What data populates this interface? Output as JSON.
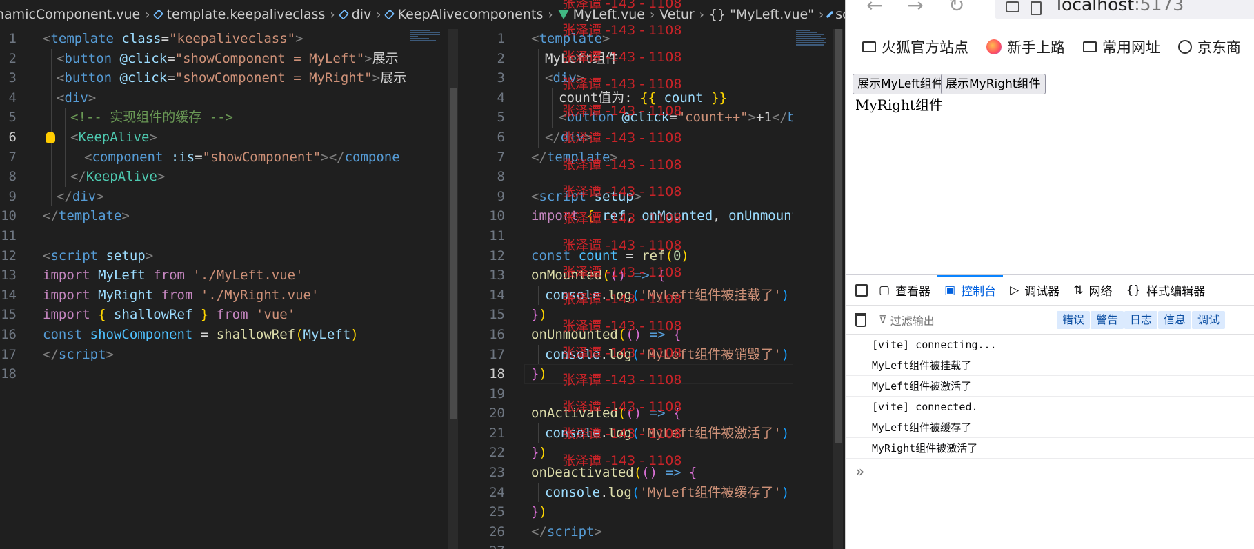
{
  "left_editor": {
    "breadcrumbs": [
      "namicComponent.vue",
      "template.keepaliveclass",
      "div",
      "KeepAlive"
    ],
    "current_line": 6,
    "lines": [
      {
        "n": "1",
        "tokens": [
          [
            "<",
            "ang"
          ],
          [
            "template",
            "tag"
          ],
          [
            " ",
            ""
          ],
          [
            "class",
            "attr"
          ],
          [
            "=",
            ""
          ],
          [
            "\"keepaliveclass\"",
            "str"
          ],
          [
            ">",
            "ang"
          ]
        ],
        "indent": 0
      },
      {
        "n": "2",
        "tokens": [
          [
            "<",
            "ang"
          ],
          [
            "button",
            "tag"
          ],
          [
            " ",
            ""
          ],
          [
            "@click",
            "attr"
          ],
          [
            "=",
            ""
          ],
          [
            "\"showComponent = MyLeft\"",
            "str"
          ],
          [
            ">",
            "ang"
          ],
          [
            "展示",
            "plain"
          ]
        ],
        "indent": 1
      },
      {
        "n": "3",
        "tokens": [
          [
            "<",
            "ang"
          ],
          [
            "button",
            "tag"
          ],
          [
            " ",
            ""
          ],
          [
            "@click",
            "attr"
          ],
          [
            "=",
            ""
          ],
          [
            "\"showComponent = MyRight\"",
            "str"
          ],
          [
            ">",
            "ang"
          ],
          [
            "展示",
            "plain"
          ]
        ],
        "indent": 1
      },
      {
        "n": "4",
        "tokens": [
          [
            "<",
            "ang"
          ],
          [
            "div",
            "tag"
          ],
          [
            ">",
            "ang"
          ]
        ],
        "indent": 1
      },
      {
        "n": "5",
        "tokens": [
          [
            "<!-- 实现组件的缓存 -->",
            "cmt"
          ]
        ],
        "indent": 2
      },
      {
        "n": "6",
        "tokens": [
          [
            "<",
            "ang"
          ],
          [
            "KeepAlive",
            "comp"
          ],
          [
            ">",
            "ang"
          ]
        ],
        "indent": 2
      },
      {
        "n": "7",
        "tokens": [
          [
            "<",
            "ang"
          ],
          [
            "component",
            "tag"
          ],
          [
            " ",
            ""
          ],
          [
            ":is",
            "attr"
          ],
          [
            "=",
            ""
          ],
          [
            "\"showComponent\"",
            "str"
          ],
          [
            ">",
            "ang"
          ],
          [
            "</",
            "ang"
          ],
          [
            "compone",
            "tag"
          ]
        ],
        "indent": 3
      },
      {
        "n": "8",
        "tokens": [
          [
            "</",
            "ang"
          ],
          [
            "KeepAlive",
            "comp"
          ],
          [
            ">",
            "ang"
          ]
        ],
        "indent": 2
      },
      {
        "n": "9",
        "tokens": [
          [
            "</",
            "ang"
          ],
          [
            "div",
            "tag"
          ],
          [
            ">",
            "ang"
          ]
        ],
        "indent": 1
      },
      {
        "n": "10",
        "tokens": [
          [
            "</",
            "ang"
          ],
          [
            "template",
            "tag"
          ],
          [
            ">",
            "ang"
          ]
        ],
        "indent": 0
      },
      {
        "n": "11",
        "tokens": [],
        "indent": 0
      },
      {
        "n": "12",
        "tokens": [
          [
            "<",
            "ang"
          ],
          [
            "script",
            "tag"
          ],
          [
            " ",
            ""
          ],
          [
            "setup",
            "attr"
          ],
          [
            ">",
            "ang"
          ]
        ],
        "indent": 0
      },
      {
        "n": "13",
        "tokens": [
          [
            "import",
            "kwc"
          ],
          [
            " ",
            ""
          ],
          [
            "MyLeft",
            "var"
          ],
          [
            " ",
            ""
          ],
          [
            "from",
            "kwc"
          ],
          [
            " ",
            ""
          ],
          [
            "'./MyLeft.vue'",
            "str"
          ]
        ],
        "indent": 0
      },
      {
        "n": "14",
        "tokens": [
          [
            "import",
            "kwc"
          ],
          [
            " ",
            ""
          ],
          [
            "MyRight",
            "var"
          ],
          [
            " ",
            ""
          ],
          [
            "from",
            "kwc"
          ],
          [
            " ",
            ""
          ],
          [
            "'./MyRight.vue'",
            "str"
          ]
        ],
        "indent": 0
      },
      {
        "n": "15",
        "tokens": [
          [
            "import",
            "kwc"
          ],
          [
            " ",
            ""
          ],
          [
            "{",
            "br1"
          ],
          [
            " ",
            ""
          ],
          [
            "shallowRef",
            "var"
          ],
          [
            " ",
            ""
          ],
          [
            "}",
            "br1"
          ],
          [
            " ",
            ""
          ],
          [
            "from",
            "kwc"
          ],
          [
            " ",
            ""
          ],
          [
            "'vue'",
            "str"
          ]
        ],
        "indent": 0
      },
      {
        "n": "16",
        "tokens": [
          [
            "const",
            "kw"
          ],
          [
            " ",
            ""
          ],
          [
            "showComponent",
            "cvar"
          ],
          [
            " = ",
            ""
          ],
          [
            "shallowRef",
            "fn"
          ],
          [
            "(",
            "br1"
          ],
          [
            "MyLeft",
            "var"
          ],
          [
            ")",
            "br1"
          ]
        ],
        "indent": 0
      },
      {
        "n": "17",
        "tokens": [
          [
            "</",
            "ang"
          ],
          [
            "script",
            "tag"
          ],
          [
            ">",
            "ang"
          ]
        ],
        "indent": 0
      },
      {
        "n": "18",
        "tokens": [],
        "indent": 0
      }
    ]
  },
  "right_editor": {
    "breadcrumbs": [
      "components",
      "MyLeft.vue",
      "Vetur",
      "\"MyLeft.vue\"",
      "sc"
    ],
    "current_line": 18,
    "lines": [
      {
        "n": "1",
        "tokens": [
          [
            "<",
            "ang"
          ],
          [
            "template",
            "tag"
          ],
          [
            ">",
            "ang"
          ]
        ],
        "indent": 0
      },
      {
        "n": "2",
        "tokens": [
          [
            "MyLeft组件",
            "plain"
          ]
        ],
        "indent": 1
      },
      {
        "n": "3",
        "tokens": [
          [
            "<",
            "ang"
          ],
          [
            "div",
            "tag"
          ],
          [
            ">",
            "ang"
          ]
        ],
        "indent": 1
      },
      {
        "n": "4",
        "tokens": [
          [
            "count值为:",
            "plain"
          ],
          [
            " ",
            ""
          ],
          [
            "{{",
            "br1"
          ],
          [
            " ",
            ""
          ],
          [
            "count",
            "var"
          ],
          [
            " ",
            ""
          ],
          [
            "}}",
            "br1"
          ]
        ],
        "indent": 2
      },
      {
        "n": "5",
        "tokens": [
          [
            "<",
            "ang"
          ],
          [
            "button",
            "tag"
          ],
          [
            " ",
            ""
          ],
          [
            "@click",
            "attr"
          ],
          [
            "=",
            ""
          ],
          [
            "\"count++\"",
            "str"
          ],
          [
            ">",
            "ang"
          ],
          [
            "+1",
            "plain"
          ],
          [
            "</",
            "ang"
          ],
          [
            "b",
            "tag"
          ]
        ],
        "indent": 2
      },
      {
        "n": "6",
        "tokens": [
          [
            "</",
            "ang"
          ],
          [
            "div",
            "tag"
          ],
          [
            ">",
            "ang"
          ]
        ],
        "indent": 1
      },
      {
        "n": "7",
        "tokens": [
          [
            "</",
            "ang"
          ],
          [
            "template",
            "tag"
          ],
          [
            ">",
            "ang"
          ]
        ],
        "indent": 0
      },
      {
        "n": "8",
        "tokens": [],
        "indent": 0
      },
      {
        "n": "9",
        "tokens": [
          [
            "<",
            "ang"
          ],
          [
            "script",
            "tag"
          ],
          [
            " ",
            ""
          ],
          [
            "setup",
            "attr"
          ],
          [
            ">",
            "ang"
          ]
        ],
        "indent": 0
      },
      {
        "n": "10",
        "tokens": [
          [
            "import",
            "kwc"
          ],
          [
            " ",
            ""
          ],
          [
            "{",
            "br1"
          ],
          [
            " ",
            ""
          ],
          [
            "ref",
            "var"
          ],
          [
            ", ",
            ""
          ],
          [
            "onMounted",
            "var"
          ],
          [
            ", ",
            ""
          ],
          [
            "onUnmount",
            "var"
          ]
        ],
        "indent": 0
      },
      {
        "n": "11",
        "tokens": [],
        "indent": 0
      },
      {
        "n": "12",
        "tokens": [
          [
            "const",
            "kw"
          ],
          [
            " ",
            ""
          ],
          [
            "count",
            "cvar"
          ],
          [
            " = ",
            ""
          ],
          [
            "ref",
            "fn"
          ],
          [
            "(",
            "br1"
          ],
          [
            "0",
            "num"
          ],
          [
            ")",
            "br1"
          ]
        ],
        "indent": 0
      },
      {
        "n": "13",
        "tokens": [
          [
            "onMounted",
            "fn"
          ],
          [
            "(",
            "br1"
          ],
          [
            "(",
            "br2"
          ],
          [
            ")",
            "br2"
          ],
          [
            " ",
            ""
          ],
          [
            "=>",
            "kw"
          ],
          [
            " ",
            ""
          ],
          [
            "{",
            "br2"
          ]
        ],
        "indent": 0
      },
      {
        "n": "14",
        "tokens": [
          [
            "console",
            "var"
          ],
          [
            ".",
            ""
          ],
          [
            "log",
            "fn"
          ],
          [
            "(",
            "br3"
          ],
          [
            "'MyLeft组件被挂载了'",
            "str"
          ],
          [
            ")",
            "br3"
          ]
        ],
        "indent": 1
      },
      {
        "n": "15",
        "tokens": [
          [
            "}",
            "br2"
          ],
          [
            ")",
            "br1"
          ]
        ],
        "indent": 0
      },
      {
        "n": "16",
        "tokens": [
          [
            "onUnmounted",
            "fn"
          ],
          [
            "(",
            "br1"
          ],
          [
            "(",
            "br2"
          ],
          [
            ")",
            "br2"
          ],
          [
            " ",
            ""
          ],
          [
            "=>",
            "kw"
          ],
          [
            " ",
            ""
          ],
          [
            "{",
            "br2"
          ]
        ],
        "indent": 0
      },
      {
        "n": "17",
        "tokens": [
          [
            "console",
            "var"
          ],
          [
            ".",
            ""
          ],
          [
            "log",
            "fn"
          ],
          [
            "(",
            "br3"
          ],
          [
            "'MyLeft组件被销毁了'",
            "str"
          ],
          [
            ")",
            "br3"
          ]
        ],
        "indent": 1
      },
      {
        "n": "18",
        "tokens": [
          [
            "}",
            "br2"
          ],
          [
            ")",
            "br1"
          ]
        ],
        "indent": 0
      },
      {
        "n": "19",
        "tokens": [],
        "indent": 0
      },
      {
        "n": "20",
        "tokens": [
          [
            "onActivated",
            "fn"
          ],
          [
            "(",
            "br1"
          ],
          [
            "(",
            "br2"
          ],
          [
            ")",
            "br2"
          ],
          [
            " ",
            ""
          ],
          [
            "=>",
            "kw"
          ],
          [
            " ",
            ""
          ],
          [
            "{",
            "br2"
          ]
        ],
        "indent": 0
      },
      {
        "n": "21",
        "tokens": [
          [
            "console",
            "var"
          ],
          [
            ".",
            ""
          ],
          [
            "log",
            "fn"
          ],
          [
            "(",
            "br3"
          ],
          [
            "'MyLeft组件被激活了'",
            "str"
          ],
          [
            ")",
            "br3"
          ]
        ],
        "indent": 1
      },
      {
        "n": "22",
        "tokens": [
          [
            "}",
            "br2"
          ],
          [
            ")",
            "br1"
          ]
        ],
        "indent": 0
      },
      {
        "n": "23",
        "tokens": [
          [
            "onDeactivated",
            "fn"
          ],
          [
            "(",
            "br1"
          ],
          [
            "(",
            "br2"
          ],
          [
            ")",
            "br2"
          ],
          [
            " ",
            ""
          ],
          [
            "=>",
            "kw"
          ],
          [
            " ",
            ""
          ],
          [
            "{",
            "br2"
          ]
        ],
        "indent": 0
      },
      {
        "n": "24",
        "tokens": [
          [
            "console",
            "var"
          ],
          [
            ".",
            ""
          ],
          [
            "log",
            "fn"
          ],
          [
            "(",
            "br3"
          ],
          [
            "'MyLeft组件被缓存了'",
            "str"
          ],
          [
            ")",
            "br3"
          ]
        ],
        "indent": 1
      },
      {
        "n": "25",
        "tokens": [
          [
            "}",
            "br2"
          ],
          [
            ")",
            "br1"
          ]
        ],
        "indent": 0
      },
      {
        "n": "26",
        "tokens": [
          [
            "</",
            "ang"
          ],
          [
            "script",
            "tag"
          ],
          [
            ">",
            "ang"
          ]
        ],
        "indent": 0
      },
      {
        "n": "27",
        "tokens": [],
        "indent": 0
      }
    ],
    "watermark": "张泽谭 -143 - 1108",
    "watermark_count": 18
  },
  "browser": {
    "url_host": "localhost",
    "url_port": ":5173",
    "bookmarks": [
      "火狐官方站点",
      "新手上路",
      "常用网址",
      "京东商"
    ],
    "page": {
      "btn_left": "展示MyLeft组件",
      "btn_right": "展示MyRight组件",
      "text": "MyRight组件"
    },
    "devtools": {
      "tabs": [
        "查看器",
        "控制台",
        "调试器",
        "网络",
        "样式编辑器"
      ],
      "active_tab": "控制台",
      "filter_placeholder": "过滤输出",
      "levels": [
        "错误",
        "警告",
        "日志",
        "信息",
        "调试"
      ],
      "console_lines": [
        "[vite] connecting...",
        "MyLeft组件被挂载了",
        "MyLeft组件被激活了",
        "[vite] connected.",
        "MyLeft组件被缓存了",
        "MyRight组件被激活了"
      ],
      "prompt": "»"
    }
  }
}
